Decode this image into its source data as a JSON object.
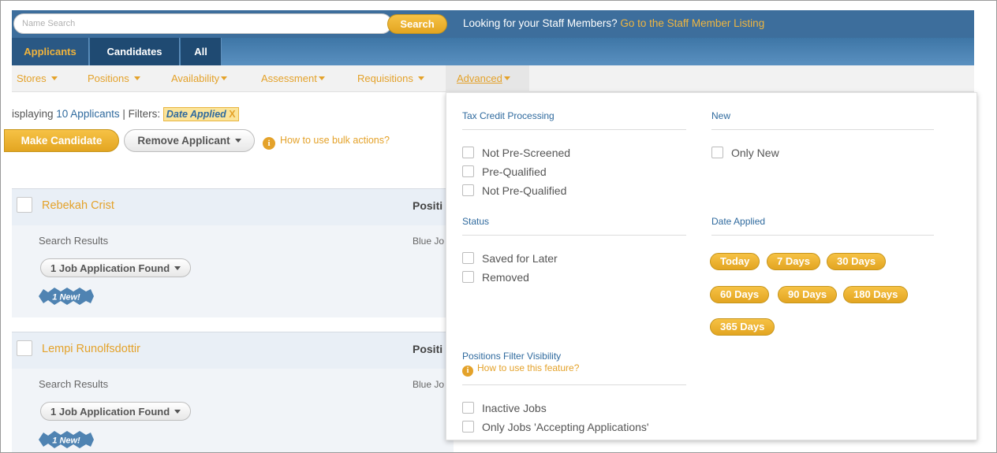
{
  "search": {
    "placeholder": "Name Search",
    "button_label": "Search"
  },
  "staff_message": {
    "text": "Looking for your Staff Members? ",
    "link": "Go to the Staff Member Listing"
  },
  "tabs": [
    {
      "label": "Applicants",
      "active": true
    },
    {
      "label": "Candidates"
    },
    {
      "label": "All"
    }
  ],
  "filter_nav": [
    {
      "label": "Stores"
    },
    {
      "label": "Positions"
    },
    {
      "label": "Availability"
    },
    {
      "label": "Assessment"
    },
    {
      "label": "Requisitions"
    },
    {
      "label": "Advanced",
      "active": true
    }
  ],
  "listing": {
    "displaying_prefix": "isplaying ",
    "displaying_count": "10 Applicants",
    "filters_text": " | Filters: ",
    "filter_tag": "Date Applied",
    "filter_tag_remove": "X"
  },
  "bulk_actions": {
    "make_candidate": "Make Candidate",
    "remove_applicant": "Remove Applicant",
    "help": "How to use bulk actions?"
  },
  "applicants": [
    {
      "name": "Rebekah Crist",
      "position_header": "Positi",
      "subtitle": "Search Results",
      "position_value": "Blue Jo",
      "jobs_label": "1 Job Application Found",
      "badge": "1 New!"
    },
    {
      "name": "Lempi Runolfsdottir",
      "position_header": "Positi",
      "subtitle": "Search Results",
      "position_value": "Blue Jo",
      "jobs_label": "1 Job Application Found",
      "badge": "1 New!"
    }
  ],
  "advanced": {
    "tax_credit": {
      "title": "Tax Credit Processing",
      "options": [
        "Not Pre-Screened",
        "Pre-Qualified",
        "Not Pre-Qualified"
      ]
    },
    "new": {
      "title": "New",
      "options": [
        "Only New"
      ]
    },
    "status": {
      "title": "Status",
      "options": [
        "Saved for Later",
        "Removed"
      ]
    },
    "date_applied": {
      "title": "Date Applied",
      "options": [
        "Today",
        "7 Days",
        "30 Days",
        "60 Days",
        "90 Days",
        "180 Days",
        "365 Days"
      ]
    },
    "positions_visibility": {
      "title": "Positions Filter Visibility",
      "help": "How to use this feature?",
      "options": [
        "Inactive Jobs",
        "Only Jobs 'Accepting Applications'"
      ]
    }
  },
  "colors": {
    "header_blue": "#3d6e9c",
    "accent_orange": "#e4a22a",
    "link_blue": "#2f6a9e"
  }
}
